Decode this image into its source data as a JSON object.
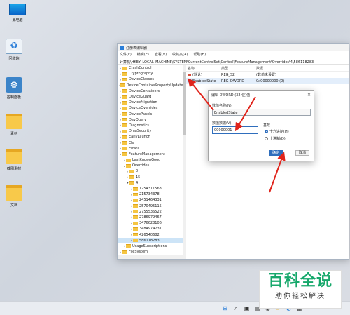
{
  "desktop": {
    "icons": [
      {
        "name": "this-pc-icon",
        "label": "此电脑"
      },
      {
        "name": "recycle-bin-icon",
        "label": "回收站"
      },
      {
        "name": "control-panel-icon",
        "label": "控制面板"
      },
      {
        "name": "folder-icon",
        "label": "素材"
      },
      {
        "name": "folder-icon",
        "label": "截图素材"
      },
      {
        "name": "folder-icon",
        "label": "文档"
      }
    ]
  },
  "window": {
    "title": "注册表编辑器",
    "menu": [
      "文件(F)",
      "编辑(E)",
      "查看(V)",
      "收藏夹(A)",
      "帮助(H)"
    ],
    "path": "计算机\\HKEY_LOCAL_MACHINE\\SYSTEM\\CurrentControlSet\\Control\\FeatureManagement\\Overrides\\4\\586118283"
  },
  "tree": [
    {
      "label": "CrashControl",
      "indent": 0,
      "open": false
    },
    {
      "label": "Cryptography",
      "indent": 0,
      "open": false
    },
    {
      "label": "DeviceClasses",
      "indent": 0,
      "open": false
    },
    {
      "label": "DeviceContainerPropertyUpdateEvents",
      "indent": 0,
      "open": false
    },
    {
      "label": "DeviceContainers",
      "indent": 0,
      "open": false
    },
    {
      "label": "DeviceGuard",
      "indent": 0,
      "open": false
    },
    {
      "label": "DeviceMigration",
      "indent": 0,
      "open": false
    },
    {
      "label": "DeviceOverrides",
      "indent": 0,
      "open": false
    },
    {
      "label": "DevicePanels",
      "indent": 0,
      "open": false
    },
    {
      "label": "DevQuery",
      "indent": 0,
      "open": false
    },
    {
      "label": "Diagnostics",
      "indent": 0,
      "open": false
    },
    {
      "label": "DmaSecurity",
      "indent": 0,
      "open": false
    },
    {
      "label": "EarlyLaunch",
      "indent": 0,
      "open": false
    },
    {
      "label": "Els",
      "indent": 0,
      "open": false
    },
    {
      "label": "Errata",
      "indent": 0,
      "open": false
    },
    {
      "label": "FeatureManagement",
      "indent": 0,
      "open": true
    },
    {
      "label": "LastKnownGood",
      "indent": 1,
      "open": false
    },
    {
      "label": "Overrides",
      "indent": 1,
      "open": true
    },
    {
      "label": "0",
      "indent": 2,
      "open": false
    },
    {
      "label": "15",
      "indent": 2,
      "open": false
    },
    {
      "label": "4",
      "indent": 2,
      "open": true
    },
    {
      "label": "1254311563",
      "indent": 3,
      "open": false
    },
    {
      "label": "215734378",
      "indent": 3,
      "open": false
    },
    {
      "label": "2451464331",
      "indent": 3,
      "open": false
    },
    {
      "label": "2570495115",
      "indent": 3,
      "open": false
    },
    {
      "label": "2755536522",
      "indent": 3,
      "open": false
    },
    {
      "label": "2786979467",
      "indent": 3,
      "open": false
    },
    {
      "label": "3476628106",
      "indent": 3,
      "open": false
    },
    {
      "label": "3484974731",
      "indent": 3,
      "open": false
    },
    {
      "label": "426540682",
      "indent": 3,
      "open": false
    },
    {
      "label": "586118283",
      "indent": 3,
      "open": false,
      "selected": true
    },
    {
      "label": "UsageSubscriptions",
      "indent": 1,
      "open": false
    },
    {
      "label": "FileSystem",
      "indent": 0,
      "open": false
    }
  ],
  "list": {
    "headers": [
      "名称",
      "类型",
      "数据"
    ],
    "rows": [
      {
        "name": "(默认)",
        "type": "REG_SZ",
        "data": "(数值未设置)"
      },
      {
        "name": "EnabledState",
        "type": "REG_DWORD",
        "data": "0x00000000 (0)"
      }
    ]
  },
  "dialog": {
    "title": "编辑 DWORD (32 位)值",
    "name_label": "数值名称(N):",
    "name_value": "EnabledState",
    "data_label": "数值数据(V):",
    "data_value": "00000001",
    "base_label": "基数",
    "hex_label": "十六进制(H)",
    "dec_label": "十进制(D)",
    "ok_label": "确定",
    "cancel_label": "取消"
  },
  "watermark": {
    "logo": "百科全说",
    "sub": "助你轻松解决"
  },
  "colors": {
    "accent": "#2f6ebd",
    "arrow": "#e0241b",
    "watermark_green": "#17a86b"
  }
}
